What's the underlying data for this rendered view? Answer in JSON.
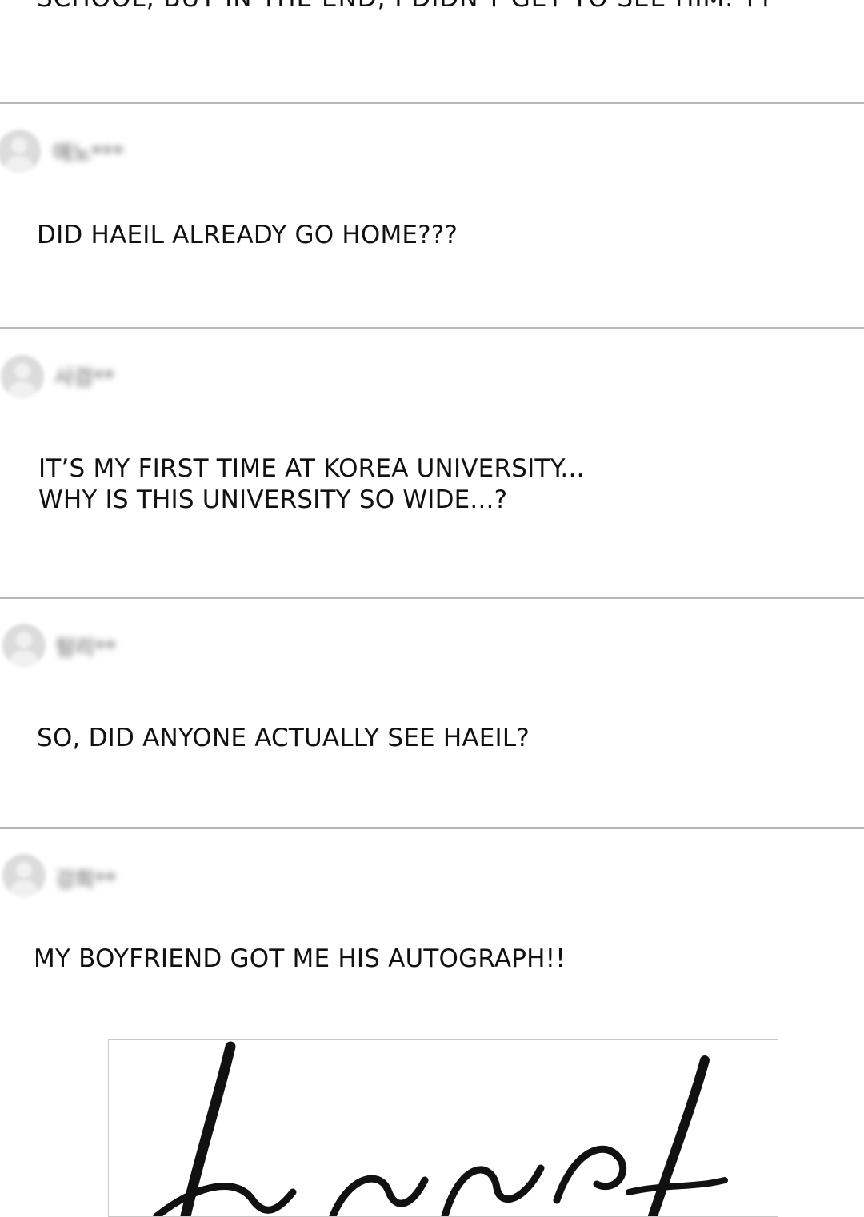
{
  "top_text": "SCHOOL, BUT IN THE END, I DIDN'T GET TO SEE HIM. TT",
  "comments": [
    {
      "name": "애노***",
      "text_lines": [
        "DID HAEIL ALREADY GO HOME???"
      ]
    },
    {
      "name": "사검**",
      "text_lines": [
        "IT’S MY FIRST TIME AT KOREA UNIVERSITY...",
        "WHY IS THIS UNIVERSITY SO WIDE...?"
      ]
    },
    {
      "name": "탐리**",
      "text_lines": [
        "SO, DID ANYONE ACTUALLY SEE HAEIL?"
      ]
    },
    {
      "name": "강희**",
      "text_lines": [
        "MY BOYFRIEND GOT ME HIS AUTOGRAPH!!"
      ]
    }
  ],
  "icons": {
    "avatar": "default-user-avatar-icon"
  },
  "colors": {
    "divider": "#b8b8b8",
    "text": "#111111",
    "background": "#ffffff"
  }
}
